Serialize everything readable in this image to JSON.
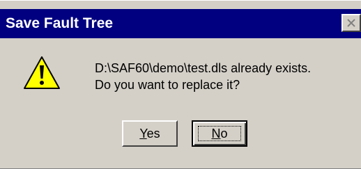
{
  "window": {
    "title": "Save Fault Tree"
  },
  "message": {
    "line1": "D:\\SAF60\\demo\\test.dls already exists.",
    "line2": "Do you want to replace it?"
  },
  "buttons": {
    "yes": {
      "mnemonic": "Y",
      "rest": "es"
    },
    "no": {
      "mnemonic": "N",
      "rest": "o"
    }
  },
  "icons": {
    "warning": "warning-icon",
    "close": "close-icon"
  },
  "colors": {
    "titlebar": "#000080",
    "dialog_bg": "#d4d0c8",
    "warning_yellow": "#ffff00"
  }
}
